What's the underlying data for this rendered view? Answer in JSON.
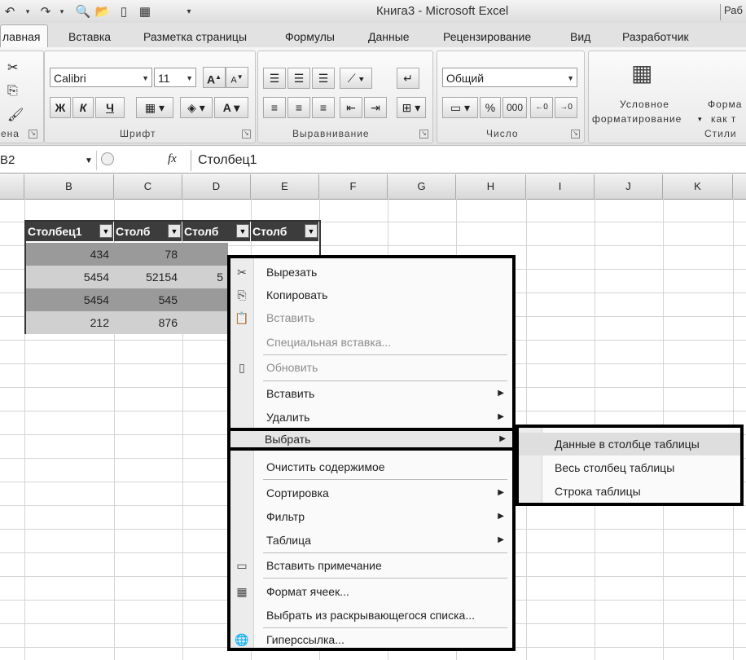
{
  "window": {
    "title": "Книга3 - Microsoft Excel",
    "right_label": "Раб"
  },
  "quick_access": [
    "undo-icon",
    "redo-icon",
    "preview-icon",
    "open-icon",
    "new-icon",
    "sheet-icon",
    "customize-icon"
  ],
  "tabs": [
    {
      "label": "лавная",
      "active": true
    },
    {
      "label": "Вставка"
    },
    {
      "label": "Разметка страницы"
    },
    {
      "label": "Формулы"
    },
    {
      "label": "Данные"
    },
    {
      "label": "Рецензирование"
    },
    {
      "label": "Вид"
    },
    {
      "label": "Разработчик"
    }
  ],
  "ribbon": {
    "clipboard_caption": "ена",
    "font": {
      "caption": "Шрифт",
      "name": "Calibri",
      "size": "11",
      "bold": "Ж",
      "italic": "К",
      "underline": "Ч",
      "grow": "A",
      "shrink": "A"
    },
    "alignment": {
      "caption": "Выравнивание"
    },
    "number": {
      "caption": "Число",
      "format": "Общий",
      "percent": "%",
      "thousands": "000"
    },
    "styles": {
      "caption": "Стили",
      "cond_line1": "Условное",
      "cond_line2": "форматирование",
      "fmt_line1": "Форма",
      "fmt_line2": "как т"
    }
  },
  "formula_bar": {
    "name_box": "B2",
    "fx": "fx",
    "content": "Столбец1"
  },
  "columns": [
    "B",
    "C",
    "D",
    "E",
    "F",
    "G",
    "H",
    "I",
    "J",
    "K"
  ],
  "table": {
    "headers": [
      "Столбец1",
      "Столб",
      "Столб",
      "Столб"
    ],
    "rows": [
      [
        "434",
        "78",
        "",
        ""
      ],
      [
        "5454",
        "52154",
        "5",
        ""
      ],
      [
        "5454",
        "545",
        "",
        ""
      ],
      [
        "212",
        "876",
        "",
        ""
      ]
    ]
  },
  "context_menu": {
    "items": [
      {
        "label": "Вырезать",
        "icon": "scissors-icon"
      },
      {
        "label": "Копировать",
        "icon": "copy-icon"
      },
      {
        "label": "Вставить",
        "icon": "paste-icon",
        "dim": true
      },
      {
        "label": "Специальная вставка...",
        "dim": true
      },
      {
        "label": "Обновить",
        "icon": "refresh-icon",
        "dim": true
      },
      {
        "label": "Вставить",
        "submenu": true
      },
      {
        "label": "Удалить",
        "submenu": true
      },
      {
        "label": "Выбрать",
        "submenu": true,
        "highlighted": true
      },
      {
        "label": "Очистить содержимое"
      },
      {
        "label": "Сортировка",
        "submenu": true
      },
      {
        "label": "Фильтр",
        "submenu": true
      },
      {
        "label": "Таблица",
        "submenu": true
      },
      {
        "label": "Вставить примечание",
        "icon": "comment-icon"
      },
      {
        "label": "Формат ячеек...",
        "icon": "format-cells-icon"
      },
      {
        "label": "Выбрать из раскрывающегося списка..."
      },
      {
        "label": "Гиперссылка...",
        "icon": "hyperlink-icon"
      }
    ]
  },
  "submenu": {
    "items": [
      {
        "label": "Данные в столбце таблицы",
        "highlighted": true
      },
      {
        "label": "Весь столбец таблицы"
      },
      {
        "label": "Строка таблицы"
      }
    ]
  }
}
